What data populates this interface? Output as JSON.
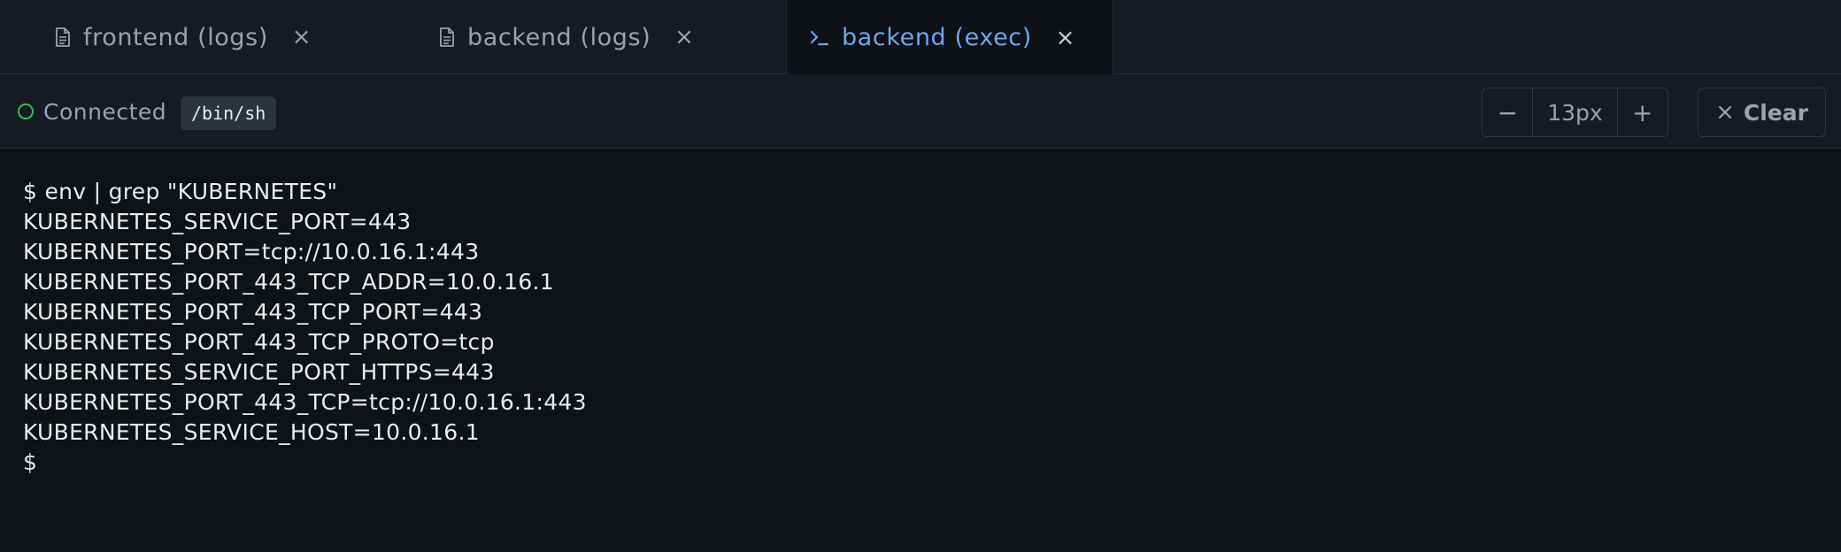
{
  "tabs": [
    {
      "label": "frontend (logs)",
      "icon": "document-icon",
      "active": false
    },
    {
      "label": "backend (logs)",
      "icon": "document-icon",
      "active": false
    },
    {
      "label": "backend (exec)",
      "icon": "terminal-prompt-icon",
      "active": true
    }
  ],
  "toolbar": {
    "status_label": "Connected",
    "shell": "/bin/sh",
    "font_size": {
      "decrease_label": "−",
      "value": "13px",
      "increase_label": "+"
    },
    "clear_label": "Clear"
  },
  "terminal": {
    "lines": [
      "$ env | grep \"KUBERNETES\"",
      "KUBERNETES_SERVICE_PORT=443",
      "KUBERNETES_PORT=tcp://10.0.16.1:443",
      "KUBERNETES_PORT_443_TCP_ADDR=10.0.16.1",
      "KUBERNETES_PORT_443_TCP_PORT=443",
      "KUBERNETES_PORT_443_TCP_PROTO=tcp",
      "KUBERNETES_SERVICE_PORT_HTTPS=443",
      "KUBERNETES_PORT_443_TCP=tcp://10.0.16.1:443",
      "KUBERNETES_SERVICE_HOST=10.0.16.1",
      "$"
    ]
  },
  "colors": {
    "accent": "#6aa8f0",
    "status_connected": "#3fb950",
    "background": "#0f1217",
    "chrome": "#161b23"
  }
}
